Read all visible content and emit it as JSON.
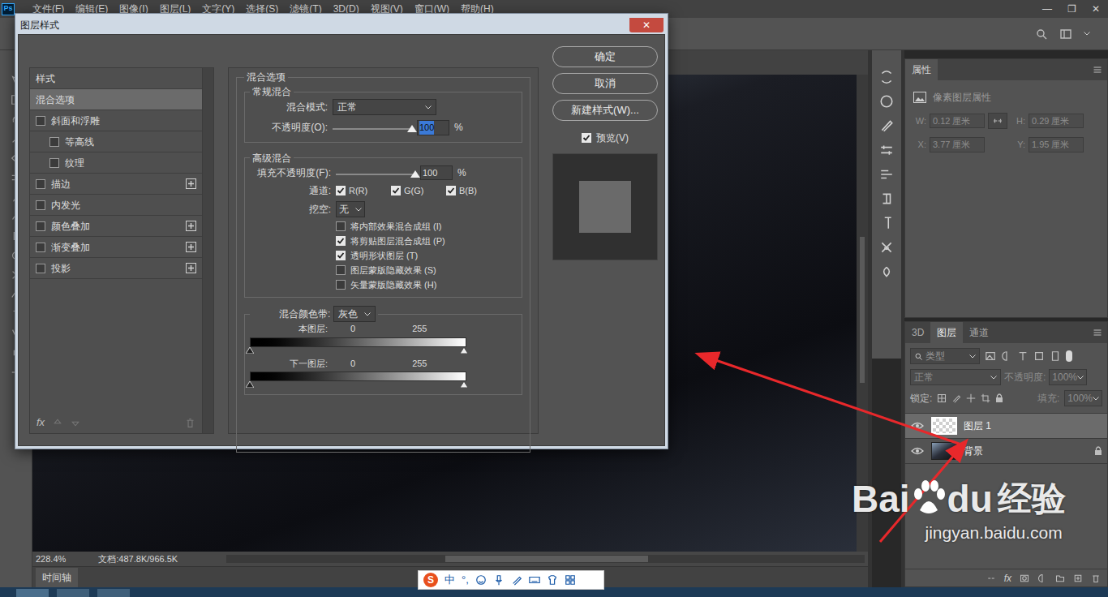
{
  "app": {
    "logo": "Ps",
    "window_controls": [
      "—",
      "❐",
      "✕"
    ]
  },
  "menubar": [
    "文件(F)",
    "编辑(E)",
    "图像(I)",
    "图层(L)",
    "文字(Y)",
    "选择(S)",
    "滤镜(T)",
    "3D(D)",
    "视图(V)",
    "窗口(W)",
    "帮助(H)"
  ],
  "fx": "fx",
  "dialog": {
    "title": "图层样式",
    "close": "✕",
    "styles_header": "样式",
    "styles": [
      {
        "label": "混合选项",
        "kind": "plain",
        "selected": true,
        "checked": false,
        "add": false
      },
      {
        "label": "斜面和浮雕",
        "kind": "check",
        "selected": false,
        "checked": false,
        "add": false
      },
      {
        "label": "等高线",
        "kind": "sub",
        "selected": false,
        "checked": false,
        "add": false
      },
      {
        "label": "纹理",
        "kind": "sub",
        "selected": false,
        "checked": false,
        "add": false
      },
      {
        "label": "描边",
        "kind": "check",
        "selected": false,
        "checked": false,
        "add": true
      },
      {
        "label": "内发光",
        "kind": "check",
        "selected": false,
        "checked": false,
        "add": false
      },
      {
        "label": "颜色叠加",
        "kind": "check",
        "selected": false,
        "checked": false,
        "add": true
      },
      {
        "label": "渐变叠加",
        "kind": "check",
        "selected": false,
        "checked": false,
        "add": true
      },
      {
        "label": "投影",
        "kind": "check",
        "selected": false,
        "checked": false,
        "add": true
      }
    ],
    "blending": {
      "title": "混合选项",
      "general": {
        "title": "常规混合",
        "mode_label": "混合模式:",
        "mode": "正常",
        "opacity_label": "不透明度(O):",
        "opacity": "100",
        "opacity_level": 1,
        "opacity_selected": true,
        "unit": "%"
      },
      "advanced": {
        "title": "高级混合",
        "fill_label": "填充不透明度(F):",
        "fill": "100",
        "fill_level": 1,
        "unit": "%",
        "channels_label": "通道:",
        "channels": [
          {
            "label": "R(R)",
            "checked": true
          },
          {
            "label": "G(G)",
            "checked": true
          },
          {
            "label": "B(B)",
            "checked": true
          }
        ],
        "knockout_label": "挖空:",
        "knockout": "无",
        "options": [
          {
            "label": "将内部效果混合成组 (I)",
            "checked": false
          },
          {
            "label": "将剪贴图层混合成组 (P)",
            "checked": true
          },
          {
            "label": "透明形状图层 (T)",
            "checked": true
          },
          {
            "label": "图层蒙版隐藏效果 (S)",
            "checked": false
          },
          {
            "label": "矢量蒙版隐藏效果 (H)",
            "checked": false
          }
        ]
      },
      "blend_if": {
        "label": "混合颜色带:",
        "value": "灰色",
        "bands": [
          {
            "label": "本图层:",
            "min": "0",
            "max": "255"
          },
          {
            "label": "下一图层:",
            "min": "0",
            "max": "255"
          }
        ]
      }
    },
    "buttons": [
      "确定",
      "取消",
      "新建样式(W)..."
    ],
    "preview": {
      "label": "预览(V)",
      "checked": true
    }
  },
  "properties": {
    "tab": "属性",
    "type": "像素图层属性",
    "rows": [
      [
        {
          "label": "W:",
          "value": "0.12 厘米",
          "disabled": true
        },
        {
          "label": "H:",
          "value": "0.29 厘米",
          "disabled": true
        }
      ],
      [
        {
          "label": "X:",
          "value": "3.77 厘米",
          "disabled": true
        },
        {
          "label": "Y:",
          "value": "1.95 厘米",
          "disabled": true
        }
      ]
    ]
  },
  "layers_panel": {
    "tabs": [
      {
        "label": "3D",
        "selected": false
      },
      {
        "label": "图层",
        "selected": true
      },
      {
        "label": "通道",
        "selected": false
      }
    ],
    "filter": "类型",
    "blend": "正常",
    "opacity_label": "不透明度:",
    "opacity": "100%",
    "lock_label": "锁定:",
    "fill_label": "填充:",
    "fill": "100%",
    "layers": [
      {
        "name": "图层 1",
        "selected": true,
        "visible": true,
        "locked": false,
        "kind": "transparent"
      },
      {
        "name": "背景",
        "selected": false,
        "visible": true,
        "locked": true,
        "kind": "photo"
      }
    ]
  },
  "status_bar": {
    "zoom": "228.4%",
    "doc": "文档:487.8K/966.5K"
  },
  "timeline": "时间轴",
  "ime": {
    "logo": "S",
    "mode": "中",
    "punct": "°,"
  },
  "watermark": {
    "left": "Bai",
    "right": "du",
    "suffix": "经验",
    "url": "jingyan.baidu.com"
  }
}
